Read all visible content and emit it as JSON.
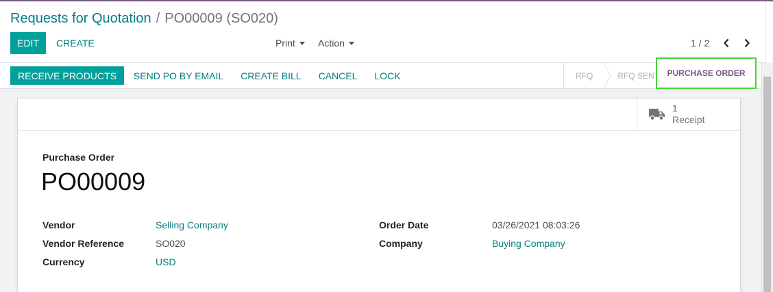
{
  "breadcrumb": {
    "parent": "Requests for Quotation",
    "separator": "/",
    "current": "PO00009 (SO020)"
  },
  "control": {
    "edit_label": "EDIT",
    "create_label": "CREATE",
    "print_label": "Print",
    "action_label": "Action",
    "pager_text": "1 / 2"
  },
  "statusbar": {
    "buttons": [
      "RECEIVE PRODUCTS",
      "SEND PO BY EMAIL",
      "CREATE BILL",
      "CANCEL",
      "LOCK"
    ],
    "stages": [
      "RFQ",
      "RFQ SENT",
      "PURCHASE ORDER"
    ],
    "current_stage": "PURCHASE ORDER"
  },
  "smart_button": {
    "count": "1",
    "label": "Receipt",
    "icon": "truck-icon"
  },
  "form": {
    "doc_type": "Purchase Order",
    "doc_name": "PO00009",
    "left_fields": [
      {
        "label": "Vendor",
        "value": "Selling Company"
      },
      {
        "label": "Vendor Reference",
        "value": "SO020"
      },
      {
        "label": "Currency",
        "value": "USD"
      }
    ],
    "right_fields": [
      {
        "label": "Order Date",
        "value": "03/26/2021 08:03:26"
      },
      {
        "label": "Company",
        "value": "Buying Company"
      }
    ]
  },
  "colors": {
    "primary": "#00a09d",
    "link": "#017e84",
    "brand": "#7c5a86",
    "highlight": "#44d63b"
  }
}
